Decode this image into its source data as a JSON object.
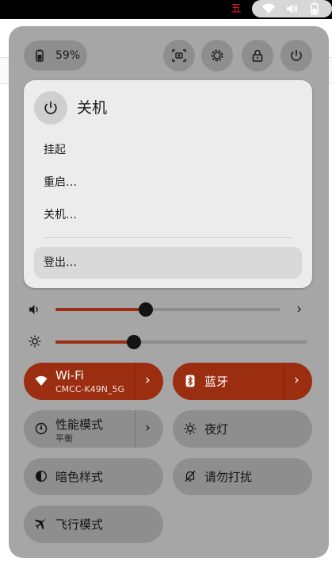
{
  "topbar": {
    "ime_label": "五",
    "tray_icons": [
      "wifi-icon",
      "volume-icon",
      "battery-icon"
    ]
  },
  "quick_settings": {
    "battery_label": "59%",
    "header_buttons": [
      "screenshot-icon",
      "settings-icon",
      "lock-icon",
      "power-icon"
    ],
    "power_menu": {
      "title": "关机",
      "items": [
        "挂起",
        "重启…",
        "关机…",
        "登出…"
      ]
    },
    "sliders": {
      "volume_level": 0.4,
      "brightness_level": 0.31
    },
    "toggles": {
      "wifi": {
        "label": "Wi-Fi",
        "subtitle": "CMCC-K49N_5G",
        "active": true
      },
      "bluetooth": {
        "label": "蓝牙",
        "active": true
      },
      "power_mode": {
        "label": "性能模式",
        "subtitle": "平衡",
        "active": false
      },
      "night_light": {
        "label": "夜灯",
        "active": false
      },
      "dark_style": {
        "label": "暗色样式",
        "active": false
      },
      "do_not_disturb": {
        "label": "请勿打扰",
        "active": false
      },
      "airplane": {
        "label": "飞行模式",
        "active": false
      }
    }
  },
  "colors": {
    "accent": "#9b2d10",
    "panel": "#a6a6a6",
    "tile": "#8e8e8e",
    "ime": "#e01b24"
  }
}
